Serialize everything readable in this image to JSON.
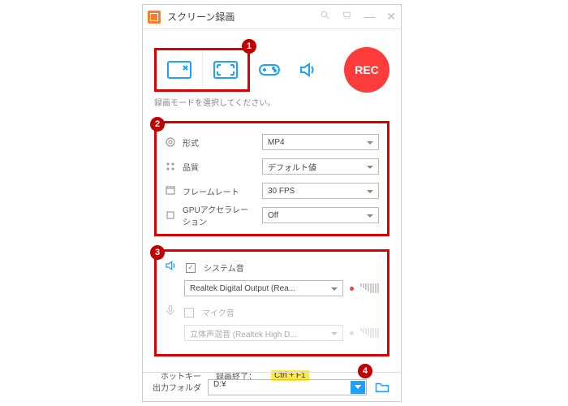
{
  "window": {
    "title": "スクリーン録画"
  },
  "modes": {
    "hint": "録画モードを選択してください。",
    "rec_label": "REC"
  },
  "badges": {
    "b1": "1",
    "b2": "2",
    "b3": "3",
    "b4": "4"
  },
  "video": {
    "format_label": "形式",
    "format_value": "MP4",
    "quality_label": "品質",
    "quality_value": "デフォルト値",
    "fps_label": "フレームレート",
    "fps_value": "30 FPS",
    "gpu_label": "GPUアクセラレーション",
    "gpu_value": "Off"
  },
  "audio": {
    "system_label": "システム音",
    "system_device": "Realtek Digital Output (Rea...",
    "mic_label": "マイク音",
    "mic_device": "立体声混音 (Realtek High D..."
  },
  "hotkey": {
    "label": "ホットキー",
    "stop_label": "録画終了：",
    "stop_value": "Ctrl + F1"
  },
  "output": {
    "label": "出力フォルダ",
    "path": "D:¥"
  }
}
